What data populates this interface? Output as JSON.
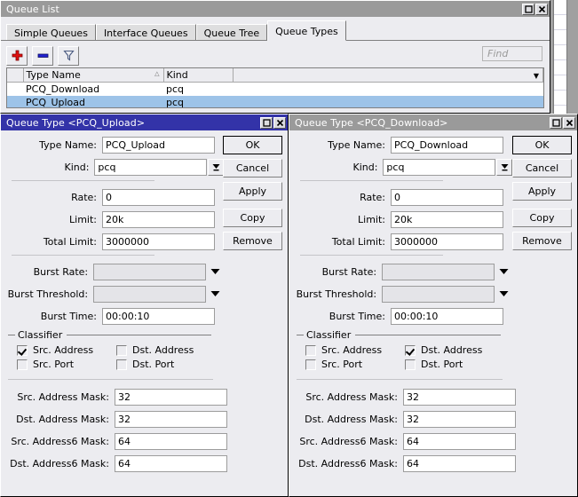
{
  "window": {
    "title": "Queue List",
    "buttons": {
      "maximize": "maximize-icon",
      "close": "close-icon"
    },
    "tabs": [
      {
        "label": "Simple Queues",
        "active": false
      },
      {
        "label": "Interface Queues",
        "active": false
      },
      {
        "label": "Queue Tree",
        "active": false
      },
      {
        "label": "Queue Types",
        "active": true
      }
    ],
    "toolbar": {
      "add_icon": "plus-icon",
      "remove_icon": "minus-icon",
      "filter_icon": "funnel-icon",
      "find_placeholder": "Find"
    },
    "table": {
      "columns": [
        "Type Name",
        "Kind",
        ""
      ],
      "rows": [
        {
          "name": "PCQ_Download",
          "kind": "pcq",
          "selected": false
        },
        {
          "name": "PCQ_Upload",
          "kind": "pcq",
          "selected": true
        }
      ]
    }
  },
  "dialogs": [
    {
      "title": "Queue Type <PCQ_Upload>",
      "active": true,
      "fields": {
        "type_name_label": "Type Name:",
        "type_name_value": "PCQ_Upload",
        "kind_label": "Kind:",
        "kind_value": "pcq",
        "rate_label": "Rate:",
        "rate_value": "0",
        "limit_label": "Limit:",
        "limit_value": "20k",
        "total_limit_label": "Total Limit:",
        "total_limit_value": "3000000",
        "burst_rate_label": "Burst Rate:",
        "burst_rate_value": "",
        "burst_threshold_label": "Burst Threshold:",
        "burst_threshold_value": "",
        "burst_time_label": "Burst Time:",
        "burst_time_value": "00:00:10"
      },
      "classifier": {
        "title": "Classifier",
        "items": [
          {
            "label": "Src. Address",
            "checked": true
          },
          {
            "label": "Dst. Address",
            "checked": false
          },
          {
            "label": "Src. Port",
            "checked": false
          },
          {
            "label": "Dst. Port",
            "checked": false
          }
        ]
      },
      "masks": [
        {
          "label": "Src. Address Mask:",
          "value": "32"
        },
        {
          "label": "Dst. Address Mask:",
          "value": "32"
        },
        {
          "label": "Src. Address6 Mask:",
          "value": "64"
        },
        {
          "label": "Dst. Address6 Mask:",
          "value": "64"
        }
      ],
      "buttons": [
        "OK",
        "Cancel",
        "Apply",
        "Copy",
        "Remove"
      ]
    },
    {
      "title": "Queue Type <PCQ_Download>",
      "active": false,
      "fields": {
        "type_name_label": "Type Name:",
        "type_name_value": "PCQ_Download",
        "kind_label": "Kind:",
        "kind_value": "pcq",
        "rate_label": "Rate:",
        "rate_value": "0",
        "limit_label": "Limit:",
        "limit_value": "20k",
        "total_limit_label": "Total Limit:",
        "total_limit_value": "3000000",
        "burst_rate_label": "Burst Rate:",
        "burst_rate_value": "",
        "burst_threshold_label": "Burst Threshold:",
        "burst_threshold_value": "",
        "burst_time_label": "Burst Time:",
        "burst_time_value": "00:00:10"
      },
      "classifier": {
        "title": "Classifier",
        "items": [
          {
            "label": "Src. Address",
            "checked": false
          },
          {
            "label": "Dst. Address",
            "checked": true
          },
          {
            "label": "Src. Port",
            "checked": false
          },
          {
            "label": "Dst. Port",
            "checked": false
          }
        ]
      },
      "masks": [
        {
          "label": "Src. Address Mask:",
          "value": "32"
        },
        {
          "label": "Dst. Address Mask:",
          "value": "32"
        },
        {
          "label": "Src. Address6 Mask:",
          "value": "64"
        },
        {
          "label": "Dst. Address6 Mask:",
          "value": "64"
        }
      ],
      "buttons": [
        "OK",
        "Cancel",
        "Apply",
        "Copy",
        "Remove"
      ]
    }
  ],
  "colors": {
    "active_title": "#3333a8",
    "inactive_title": "#9a9a9a",
    "face": "#ececf0",
    "selection": "#9dc3e8",
    "desktop": "#a0a0a0",
    "plus": "#e01010",
    "minus": "#2020d0"
  }
}
